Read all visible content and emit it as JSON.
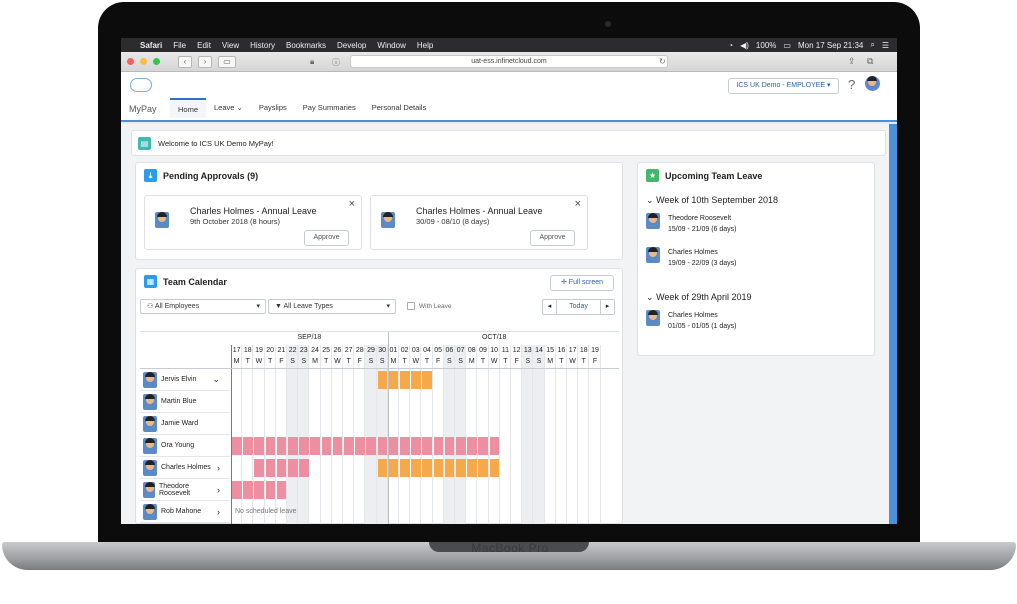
{
  "device": {
    "brand": "MacBook Pro"
  },
  "menubar": {
    "app": "Safari",
    "items": [
      "File",
      "Edit",
      "View",
      "History",
      "Bookmarks",
      "Develop",
      "Window",
      "Help"
    ],
    "battery": "100%",
    "clock": "Mon 17 Sep  21:34"
  },
  "browser": {
    "url": "uat-ess.infinetcloud.com"
  },
  "app": {
    "name": "MyPay",
    "tabs": [
      {
        "label": "Home"
      },
      {
        "label": "Leave"
      },
      {
        "label": "Payslips"
      },
      {
        "label": "Pay Summaries"
      },
      {
        "label": "Personal Details"
      }
    ],
    "role": "ICS UK Demo - EMPLOYEE",
    "help": "?"
  },
  "welcome": "Welcome to ICS UK Demo MyPay!",
  "pending": {
    "title": "Pending Approvals (9)",
    "items": [
      {
        "name": "Charles Holmes - Annual Leave",
        "dates": "9th October 2018 (8 hours)",
        "button": "Approve"
      },
      {
        "name": "Charles Holmes - Annual Leave",
        "dates": "30/09 - 08/10 (8 days)",
        "button": "Approve"
      }
    ]
  },
  "calendar": {
    "title": "Team Calendar",
    "fullscreen": "Full screen",
    "filter_employees": "All Employees",
    "filter_types": "All Leave Types",
    "with_leave": "With Leave",
    "today": "Today",
    "months": [
      "SEP/18",
      "OCT/18"
    ],
    "days": [
      "17",
      "18",
      "19",
      "20",
      "21",
      "22",
      "23",
      "24",
      "25",
      "26",
      "27",
      "28",
      "29",
      "30",
      "01",
      "02",
      "03",
      "04",
      "05",
      "06",
      "07",
      "08",
      "09",
      "10",
      "11",
      "12",
      "13",
      "14",
      "15",
      "16",
      "17",
      "18",
      "19"
    ],
    "weekdays": [
      "M",
      "T",
      "W",
      "T",
      "F",
      "S",
      "S",
      "M",
      "T",
      "W",
      "T",
      "F",
      "S",
      "S",
      "M",
      "T",
      "W",
      "T",
      "F",
      "S",
      "S",
      "M",
      "T",
      "W",
      "T",
      "F",
      "S",
      "S",
      "M",
      "T",
      "W",
      "T",
      "F"
    ],
    "employees": [
      {
        "name": "Jervis Elvin",
        "chevron": "⌄"
      },
      {
        "name": "Martin Blue",
        "chevron": ""
      },
      {
        "name": "Jamie Ward",
        "chevron": ""
      },
      {
        "name": "Ora Young",
        "chevron": ""
      },
      {
        "name": "Charles Holmes",
        "chevron": "›"
      },
      {
        "name": "Theodore Roosevelt",
        "chevron": "›"
      },
      {
        "name": "Rob Mahone",
        "chevron": "›"
      }
    ],
    "no_leave": "No scheduled leave",
    "colors": {
      "approved": "#f5a94b",
      "pending": "#ee8fa1"
    }
  },
  "upcoming": {
    "title": "Upcoming Team Leave",
    "weeks": [
      {
        "label": "Week of 10th September 2018",
        "entries": [
          {
            "name": "Theodore Roosevelt",
            "dates": "15/09 - 21/09 (6 days)"
          },
          {
            "name": "Charles Holmes",
            "dates": "19/09 - 22/09 (3 days)"
          }
        ]
      },
      {
        "label": "Week of 29th April 2019",
        "entries": [
          {
            "name": "Charles Holmes",
            "dates": "01/05 - 01/05 (1 days)"
          }
        ]
      }
    ]
  }
}
